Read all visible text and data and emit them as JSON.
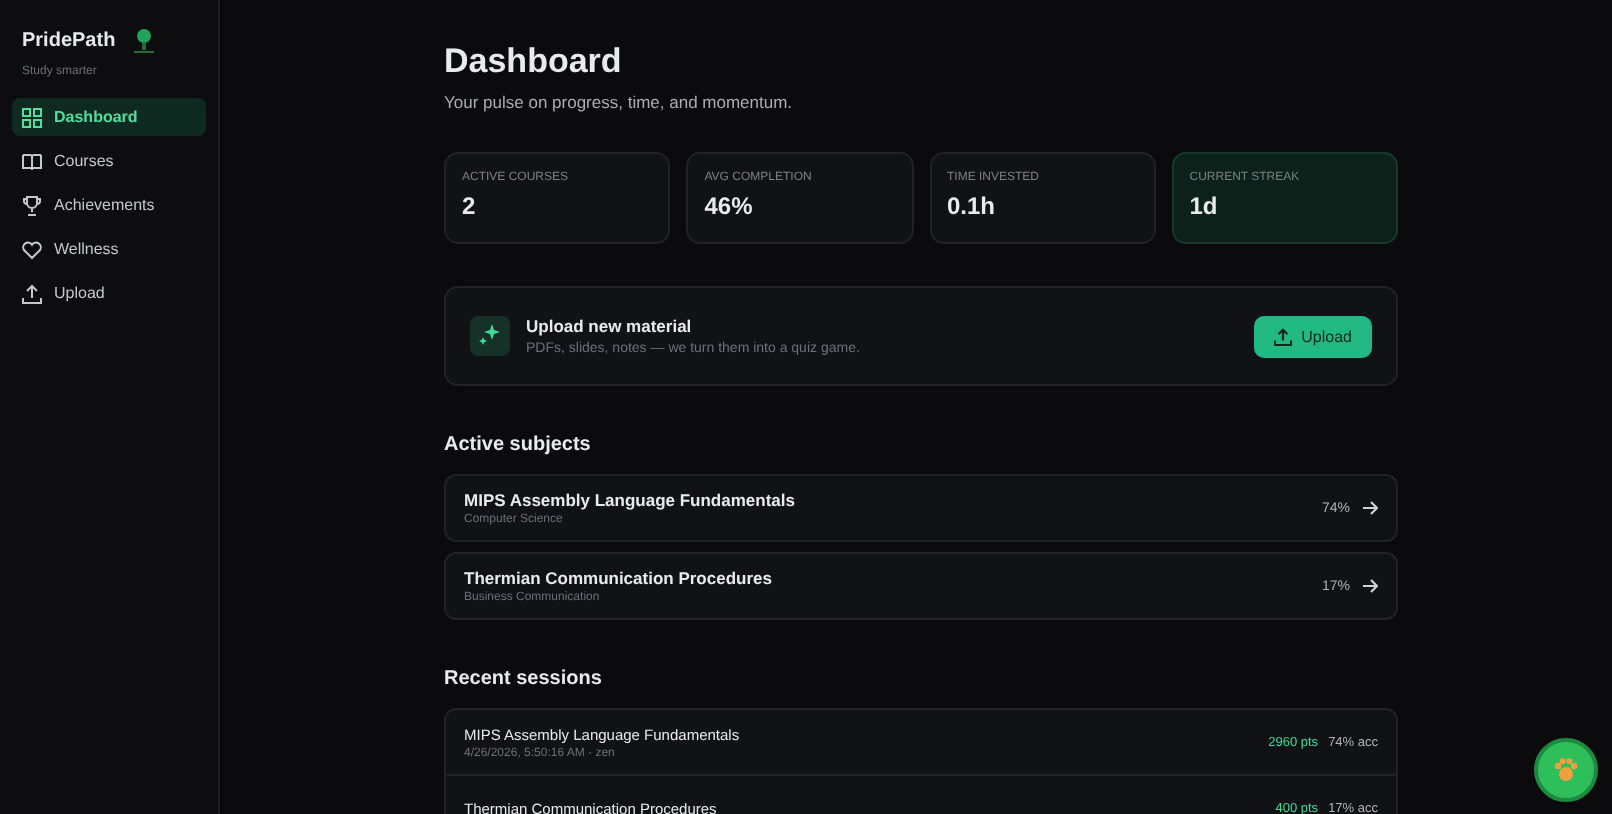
{
  "sidebar": {
    "brand": "PridePath",
    "tagline": "Study smarter",
    "items": [
      {
        "label": "Dashboard",
        "selected": true
      },
      {
        "label": "Courses",
        "selected": false
      },
      {
        "label": "Achievements",
        "selected": false
      },
      {
        "label": "Wellness",
        "selected": false
      },
      {
        "label": "Upload",
        "selected": false
      }
    ]
  },
  "header": {
    "title": "Dashboard",
    "subtitle": "Your pulse on progress, time, and momentum."
  },
  "stats": [
    {
      "label": "ACTIVE COURSES",
      "value": "2",
      "highlight": false
    },
    {
      "label": "AVG COMPLETION",
      "value": "46%",
      "highlight": false
    },
    {
      "label": "TIME INVESTED",
      "value": "0.1h",
      "highlight": false
    },
    {
      "label": "CURRENT STREAK",
      "value": "1d",
      "highlight": true
    }
  ],
  "upload_card": {
    "title": "Upload new material",
    "description": "PDFs, slides, notes — we turn them into a quiz game.",
    "button": "Upload"
  },
  "active_subjects": {
    "heading": "Active subjects",
    "items": [
      {
        "name": "MIPS Assembly Language Fundamentals",
        "category": "Computer Science",
        "progress": "74%"
      },
      {
        "name": "Thermian Communication Procedures",
        "category": "Business Communication",
        "progress": "17%"
      }
    ]
  },
  "recent_sessions": {
    "heading": "Recent sessions",
    "items": [
      {
        "name": "MIPS Assembly Language Fundamentals",
        "meta": "4/26/2026, 5:50:16 AM · zen",
        "points": "2960 pts",
        "accuracy": "74% acc"
      },
      {
        "name": "Thermian Communication Procedures",
        "points": "400 pts",
        "accuracy": "17% acc"
      }
    ]
  }
}
